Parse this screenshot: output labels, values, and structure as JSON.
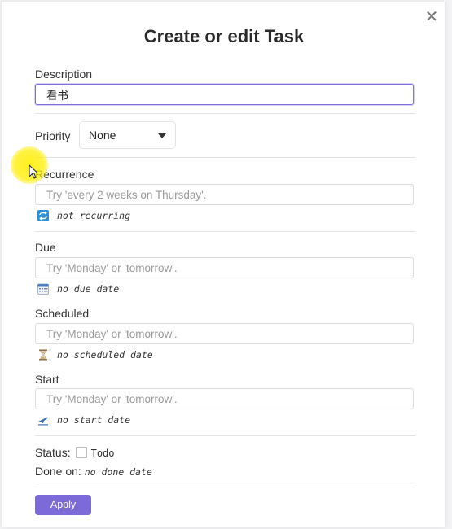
{
  "dialog": {
    "title": "Create or edit Task",
    "close_symbol": "✕"
  },
  "description": {
    "label": "Description",
    "value": "看书"
  },
  "priority": {
    "label": "Priority",
    "selected": "None"
  },
  "recurrence": {
    "label": "Recurrence",
    "placeholder": "Try 'every 2 weeks on Thursday'.",
    "hint": "not recurring",
    "icon": "repeat-icon"
  },
  "due": {
    "label": "Due",
    "placeholder": "Try 'Monday' or 'tomorrow'.",
    "hint": "no due date",
    "icon": "calendar-icon"
  },
  "scheduled": {
    "label": "Scheduled",
    "placeholder": "Try 'Monday' or 'tomorrow'.",
    "hint": "no scheduled date",
    "icon": "hourglass-icon"
  },
  "start": {
    "label": "Start",
    "placeholder": "Try 'Monday' or 'tomorrow'.",
    "hint": "no start date",
    "icon": "airplane-departure-icon"
  },
  "status": {
    "label": "Status:",
    "value": "Todo"
  },
  "done_on": {
    "label": "Done on:",
    "value": "no done date"
  },
  "actions": {
    "apply_label": "Apply"
  },
  "colors": {
    "accent": "#7d6ad9",
    "focus_border": "#8470d8"
  }
}
